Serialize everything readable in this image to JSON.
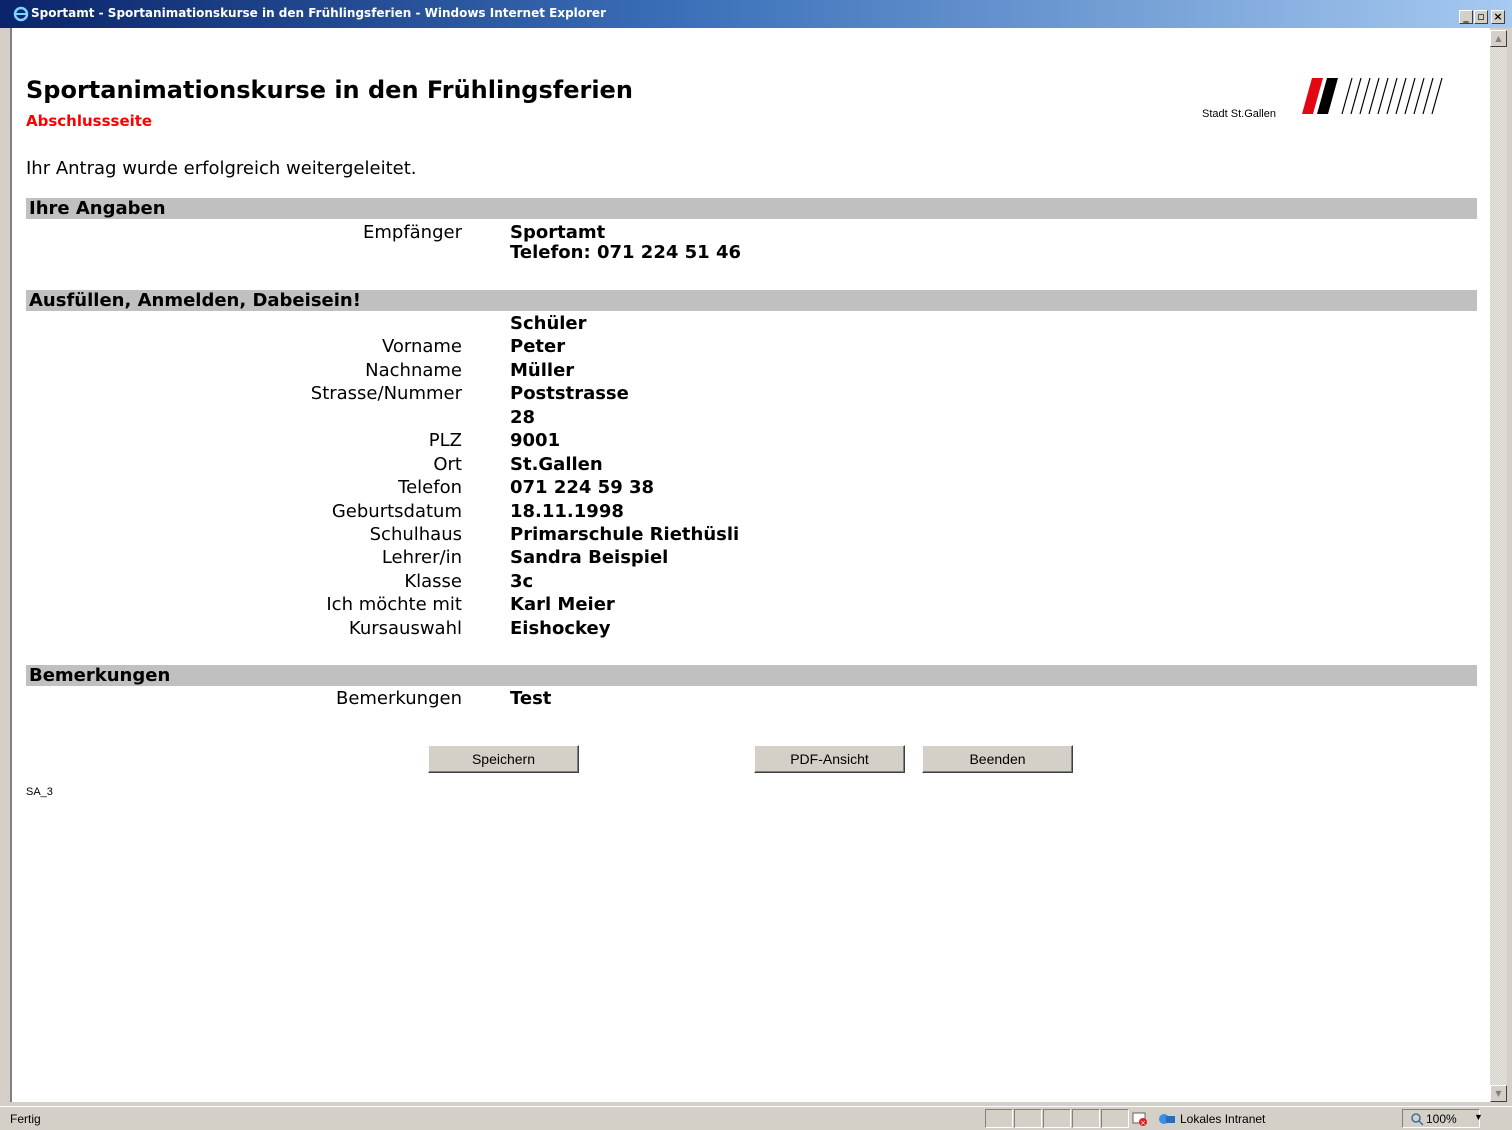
{
  "window": {
    "title": "Sportamt - Sportanimationskurse in den Frühlingsferien - Windows Internet Explorer"
  },
  "page": {
    "title": "Sportanimationskurse in den Frühlingsferien",
    "subtitle": "Abschlussseite",
    "logo_text": "Stadt St.Gallen",
    "success_message": "Ihr Antrag wurde erfolgreich weitergeleitet.",
    "page_code": "SA_3"
  },
  "sections": {
    "angaben": {
      "title": "Ihre Angaben",
      "empfaenger_label": "Empfänger",
      "empfaenger_value_1": "Sportamt",
      "empfaenger_value_2": "Telefon: 071 224 51 46"
    },
    "anmeldung": {
      "title": "Ausfüllen, Anmelden, Dabeisein!",
      "group_label": "Schüler",
      "fields": [
        {
          "label": "Vorname",
          "value": "Peter"
        },
        {
          "label": "Nachname",
          "value": "Müller"
        },
        {
          "label": "Strasse/Nummer",
          "value": "Poststrasse"
        },
        {
          "label": "",
          "value": "28"
        },
        {
          "label": "PLZ",
          "value": "9001"
        },
        {
          "label": "Ort",
          "value": "St.Gallen"
        },
        {
          "label": "Telefon",
          "value": "071 224 59 38"
        },
        {
          "label": "Geburtsdatum",
          "value": "18.11.1998"
        },
        {
          "label": "Schulhaus",
          "value": "Primarschule Riethüsli"
        },
        {
          "label": "Lehrer/in",
          "value": "Sandra Beispiel"
        },
        {
          "label": "Klasse",
          "value": "3c"
        },
        {
          "label": "Ich möchte mit",
          "value": "Karl Meier"
        },
        {
          "label": "Kursauswahl",
          "value": "Eishockey"
        }
      ]
    },
    "bemerkungen": {
      "title": "Bemerkungen",
      "label": "Bemerkungen",
      "value": "Test"
    }
  },
  "buttons": {
    "save": "Speichern",
    "pdf": "PDF-Ansicht",
    "close": "Beenden"
  },
  "statusbar": {
    "status": "Fertig",
    "zone": "Lokales Intranet",
    "zoom": "100%"
  },
  "colors": {
    "accent_red": "#e30613",
    "section_bg": "#c0c0c0",
    "titlebar": "#0a246a"
  }
}
